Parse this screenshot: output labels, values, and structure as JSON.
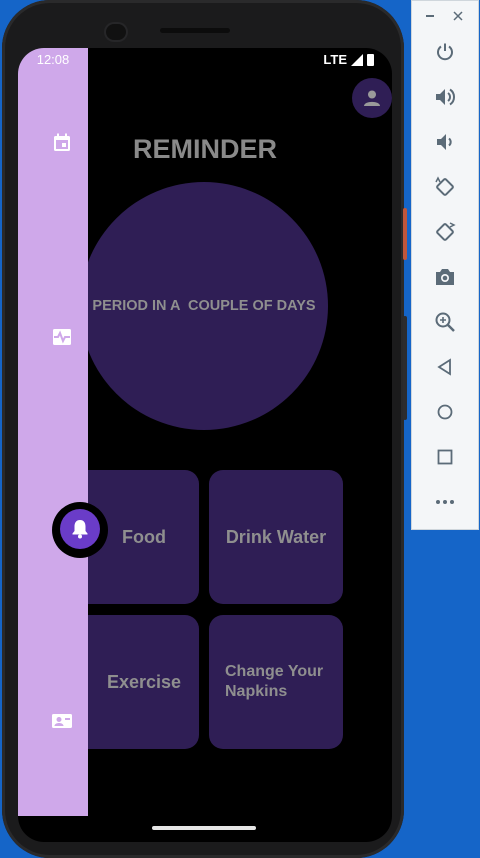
{
  "status_bar": {
    "time": "12:08",
    "network": "LTE"
  },
  "main": {
    "title": "REMINDER",
    "reminder_text": "PERIOD IN A  COUPLE OF DAYS",
    "cards": [
      {
        "label": "Food"
      },
      {
        "label": "Drink Water"
      },
      {
        "label": "Exercise"
      },
      {
        "label": "Change Your\nNapkins"
      }
    ]
  },
  "nav_rail": {
    "items": [
      {
        "icon": "calendar-icon"
      },
      {
        "icon": "heart-pulse-icon"
      },
      {
        "icon": "bell-icon",
        "selected": true
      },
      {
        "icon": "contact-card-icon"
      }
    ],
    "color": "#cfa8ea",
    "selected_color": "#6a3cc8"
  },
  "colors": {
    "card": "#2f1e55",
    "background": "#000000",
    "text": "#8f8f8f"
  },
  "emulator_panel": {
    "window_controls": [
      "minimize-icon",
      "close-icon"
    ],
    "buttons": [
      "power-icon",
      "volume-up-icon",
      "volume-down-icon",
      "rotate-left-icon",
      "rotate-right-icon",
      "camera-icon",
      "zoom-icon",
      "back-icon",
      "home-icon",
      "overview-icon",
      "more-icon"
    ]
  }
}
